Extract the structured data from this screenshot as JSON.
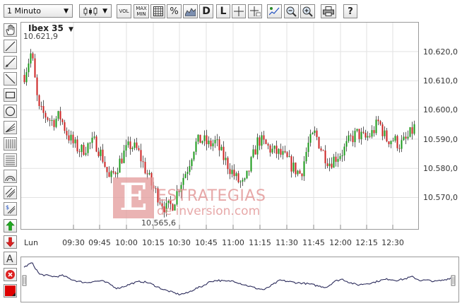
{
  "toolbar": {
    "interval": "1 Minuto",
    "buttons": {
      "vol": "VOL",
      "maxmin_top": "MAX",
      "maxmin_bottom": "MIN",
      "percent": "%",
      "d": "D",
      "l": "L",
      "help": "?"
    }
  },
  "chart": {
    "instrument": "Ibex 35",
    "high_marker": "10.621,9",
    "low_marker": "10.565,6",
    "watermark_logo": "E",
    "watermark_line1": "ESTRATEGIAS",
    "watermark_line2": "de inversion.com",
    "colors": {
      "up": "#1a9a1a",
      "down": "#cc2222",
      "wick": "#333333"
    }
  },
  "chart_data": {
    "type": "candlestick",
    "y_ticks": [
      "10.620,0",
      "10.610,0",
      "10.600,0",
      "10.590,0",
      "10.580,0",
      "10.570,0"
    ],
    "y_values": [
      10620,
      10610,
      10600,
      10590,
      10580,
      10570
    ],
    "x_ticks": [
      "Lun",
      "09:30",
      "09:45",
      "10:00",
      "10:15",
      "10:30",
      "10:45",
      "11:00",
      "11:15",
      "11:30",
      "11:45",
      "12:00",
      "12:15",
      "12:30"
    ],
    "ylim": [
      10560,
      10630
    ],
    "grid": true,
    "close_path": [
      10612,
      10620,
      10600,
      10598,
      10596,
      10598,
      10592,
      10588,
      10586,
      10588,
      10589,
      10584,
      10576,
      10580,
      10585,
      10588,
      10586,
      10580,
      10574,
      10570,
      10566,
      10568,
      10575,
      10580,
      10588,
      10590,
      10588,
      10589,
      10584,
      10580,
      10576,
      10574,
      10582,
      10590,
      10588,
      10586,
      10585,
      10583,
      10580,
      10578,
      10588,
      10592,
      10586,
      10582,
      10584,
      10586,
      10590,
      10592,
      10590,
      10592,
      10596,
      10590,
      10590,
      10588,
      10590,
      10594
    ]
  }
}
